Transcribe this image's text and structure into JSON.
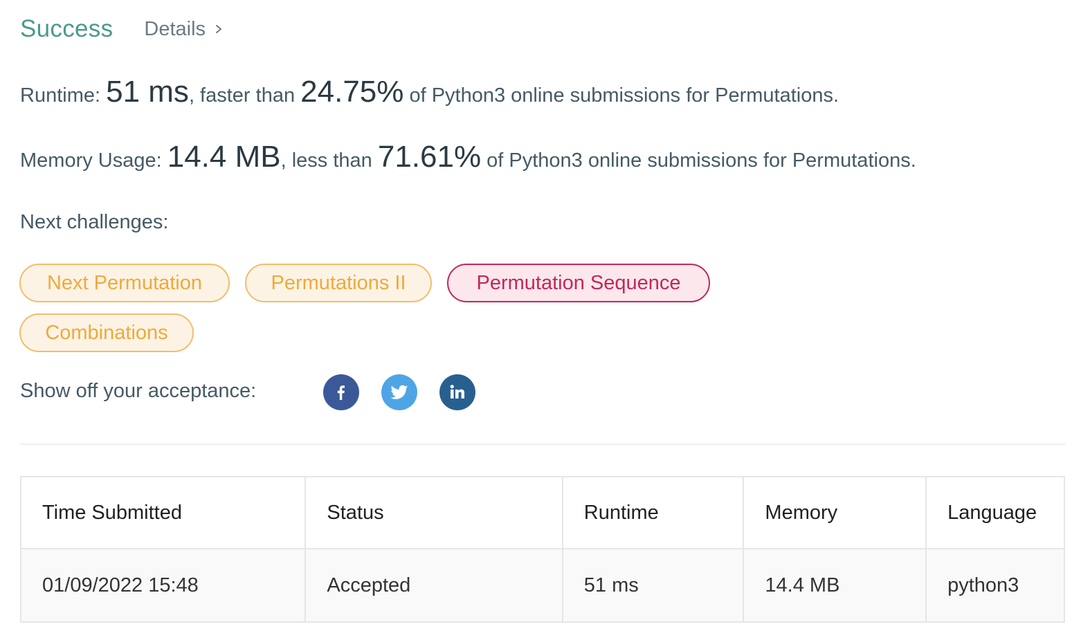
{
  "header": {
    "status": "Success",
    "details_label": "Details"
  },
  "runtime": {
    "label": "Runtime:",
    "value": "51 ms",
    "comparison": ", faster than",
    "percent": "24.75%",
    "suffix": "of Python3 online submissions for Permutations."
  },
  "memory": {
    "label": "Memory Usage:",
    "value": "14.4 MB",
    "comparison": ", less than",
    "percent": "71.61%",
    "suffix": "of Python3 online submissions for Permutations."
  },
  "next_challenges": {
    "label": "Next challenges:",
    "items": [
      {
        "title": "Next Permutation",
        "difficulty": "medium"
      },
      {
        "title": "Permutations II",
        "difficulty": "medium"
      },
      {
        "title": "Permutation Sequence",
        "difficulty": "hard"
      },
      {
        "title": "Combinations",
        "difficulty": "medium"
      }
    ]
  },
  "share": {
    "label": "Show off your acceptance:",
    "icons": [
      "facebook-icon",
      "twitter-icon",
      "linkedin-icon"
    ]
  },
  "submissions": {
    "headers": [
      "Time Submitted",
      "Status",
      "Runtime",
      "Memory",
      "Language"
    ],
    "rows": [
      {
        "time": "01/09/2022 15:48",
        "status": "Accepted",
        "runtime": "51 ms",
        "memory": "14.4 MB",
        "language": "python3"
      }
    ]
  },
  "colors": {
    "success": "#4a9a8c",
    "medium": "#efa93b",
    "hard": "#c2275b",
    "facebook": "#3b5998",
    "twitter": "#4ea5e6",
    "linkedin": "#27608f"
  }
}
